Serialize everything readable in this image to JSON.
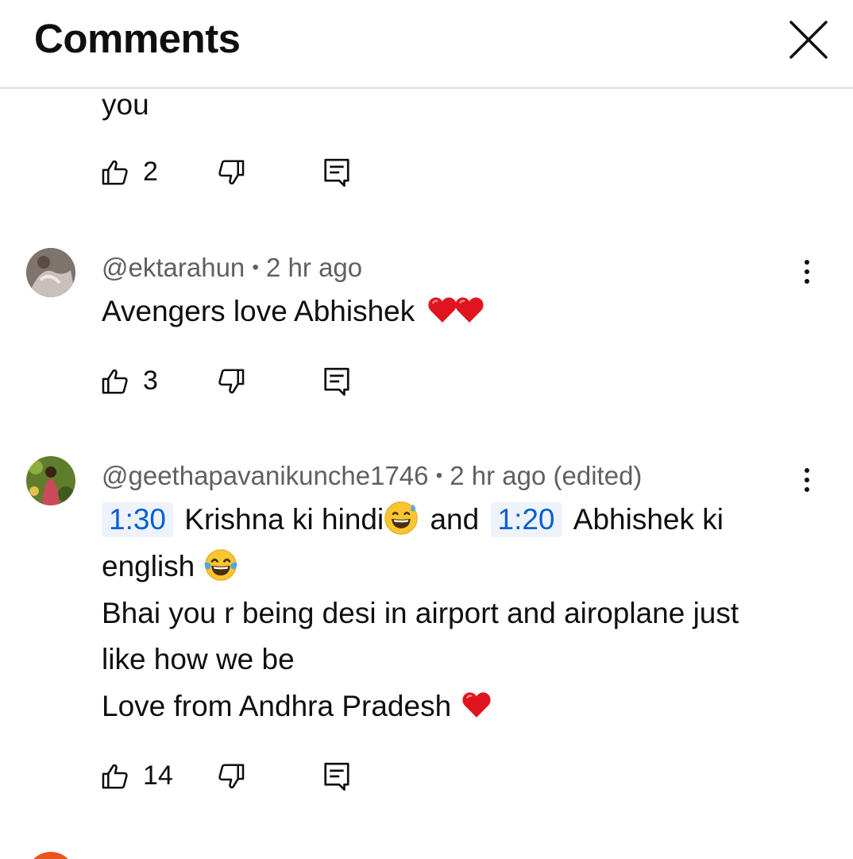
{
  "header": {
    "title": "Comments"
  },
  "comments": [
    {
      "partial_text": "you",
      "likes": "2"
    },
    {
      "author": "@ektarahun",
      "time": "2 hr ago",
      "text": "Avengers love Abhishek",
      "text_emoji": [
        "red-heart",
        "red-heart"
      ],
      "likes": "3"
    },
    {
      "author": "@geethapavanikunche1746",
      "time": "2 hr ago (edited)",
      "ts1": "1:30",
      "seg1": "Krishna ki hindi",
      "seg2": "and",
      "ts2": "1:20",
      "seg3": "Abhishek ki",
      "line2": "english",
      "line3": "Bhai you r being desi in airport and airoplane just",
      "line4": "like how we be",
      "line5": "Love from Andhra Pradesh",
      "likes": "14"
    }
  ],
  "meta_separator": "•",
  "icons": [
    "close-icon",
    "like-icon",
    "dislike-icon",
    "reply-icon",
    "more-vert-icon"
  ],
  "colors": {
    "timestamp_text": "#065fd4",
    "timestamp_bg": "#eef3fb",
    "meta_text": "#606060",
    "avatar_next": "#e8541e"
  }
}
